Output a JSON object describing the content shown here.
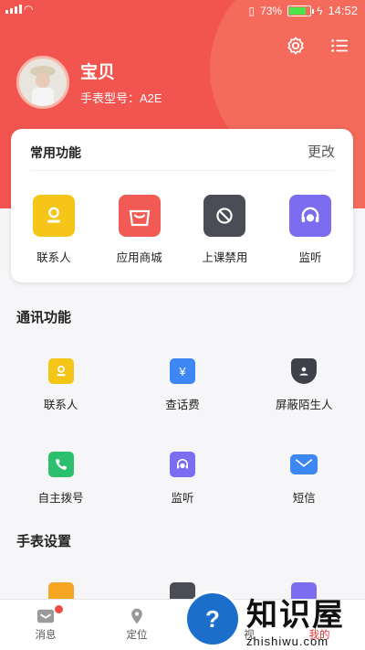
{
  "status_bar": {
    "battery_percent": "73%",
    "time": "14:52"
  },
  "header": {
    "settings_icon": "gear-icon",
    "menu_icon": "list-icon",
    "profile": {
      "name": "宝贝",
      "model": "手表型号：A2E"
    }
  },
  "frequent": {
    "title": "常用功能",
    "edit_label": "更改",
    "items": [
      {
        "label": "联系人",
        "icon": "contacts-icon",
        "color": "#f5c518"
      },
      {
        "label": "应用商城",
        "icon": "store-bag-icon",
        "color": "#f25a55"
      },
      {
        "label": "上课禁用",
        "icon": "class-disable-icon",
        "color": "#4a4d55"
      },
      {
        "label": "监听",
        "icon": "headset-icon",
        "color": "#7b6cf0"
      }
    ]
  },
  "communication": {
    "title": "通讯功能",
    "items": [
      {
        "label": "联系人",
        "icon": "contacts-icon",
        "color": "#f5c518"
      },
      {
        "label": "查话费",
        "icon": "yen-card-icon",
        "color": "#3d87f5"
      },
      {
        "label": "屏蔽陌生人",
        "icon": "shield-user-icon",
        "color": "#3f4148"
      },
      {
        "label": "自主拨号",
        "icon": "phone-icon",
        "color": "#2bbf6e"
      },
      {
        "label": "监听",
        "icon": "headset-icon",
        "color": "#7b6cf0"
      },
      {
        "label": "短信",
        "icon": "mail-icon",
        "color": "#3d87f5"
      }
    ]
  },
  "watch_settings": {
    "title": "手表设置"
  },
  "tabbar": {
    "tabs": [
      {
        "label": "消息",
        "icon": "message-icon"
      },
      {
        "label": "定位",
        "icon": "location-pin-icon"
      },
      {
        "label": "视",
        "icon": "video-icon"
      },
      {
        "label": "我的",
        "icon": "user-icon"
      }
    ]
  },
  "watermark": {
    "brand_cn": "知识屋",
    "brand_en": "zhishiwu.com"
  }
}
